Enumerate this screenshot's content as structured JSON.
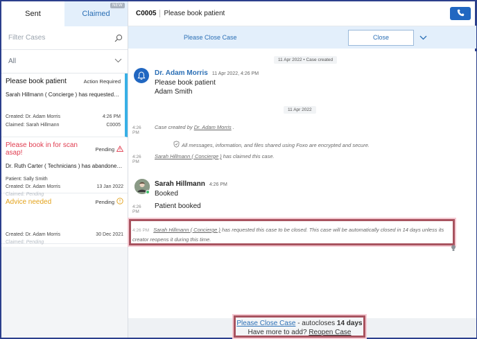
{
  "sidebar": {
    "tabs": [
      {
        "label": "Sent"
      },
      {
        "label": "Claimed",
        "badge": "NEW"
      }
    ],
    "filter": {
      "placeholder": "Filter Cases"
    },
    "dropdown": {
      "value": "All"
    },
    "cases": [
      {
        "title": "Please book patient",
        "status": "Action Required",
        "preview": "Sarah Hillmann ( Concierge ) has requested this...",
        "created_label": "Created: Dr. Adam Morris",
        "created_time": "4:26 PM",
        "claimed_label": "Claimed:  Sarah Hillmann",
        "case_id": "C0005"
      },
      {
        "title": "Please book in for scan asap!",
        "status": "Pending",
        "preview": "Dr. Ruth Carter ( Technicians ) has abandoned t...",
        "patient": "Patient: Sally Smith",
        "created_label": "Created: Dr. Adam Morris",
        "created_time": "13 Jan 2022",
        "claimed_prefix": "Claimed:",
        "claimed_value": "Pending"
      },
      {
        "title": "Advice needed",
        "status": "Pending",
        "created_label": "Created: Dr. Adam Morris",
        "created_time": "30 Dec 2021",
        "claimed_prefix": "Claimed:",
        "claimed_value": "Pending"
      }
    ]
  },
  "header": {
    "case_id": "C0005",
    "subject": "Please book patient"
  },
  "close_bar": {
    "label": "Please Close Case",
    "button": "Close"
  },
  "thread": {
    "top_pill": "11 Apr 2022 • Case created",
    "msg1": {
      "sender": "Dr. Adam Morris",
      "time": "11 Apr 2022, 4:26 PM",
      "line1": "Please book patient",
      "line2": "Adam Smith"
    },
    "day_pill": "11 Apr 2022",
    "sys1": {
      "time": "4:26 PM",
      "pre": "Case created by ",
      "who": "Dr. Adam Morris",
      "post": " ."
    },
    "secure_note": "All messages, information, and files shared using Foxo are encrypted and secure.",
    "sys2": {
      "time": "4:26 PM",
      "who": "Sarah Hillmann ( Concierge )",
      "post": " has claimed this case."
    },
    "msg2": {
      "sender": "Sarah Hillmann",
      "time": "4:26 PM",
      "line1": "Booked",
      "line2_time": "4:26 PM",
      "line2": "Patient booked"
    },
    "closing": {
      "time": "4:26 PM",
      "who": "Sarah Hillmann ( Concierge )",
      "text": " has requested this case to be closed. This case will be automatically closed in 14 days unless its creator reopens it during this time."
    }
  },
  "footer": {
    "link": "Please Close Case",
    "mid1": " - autocloses ",
    "days": "14 days",
    "line2": "Have more to add? ",
    "reopen": "Reopen Case"
  },
  "colors": {
    "accent": "#2b6fb5",
    "call_button": "#2167c1",
    "red": "#e03c4f",
    "amber": "#e3a21a",
    "highlight_border": "#a8535f"
  }
}
